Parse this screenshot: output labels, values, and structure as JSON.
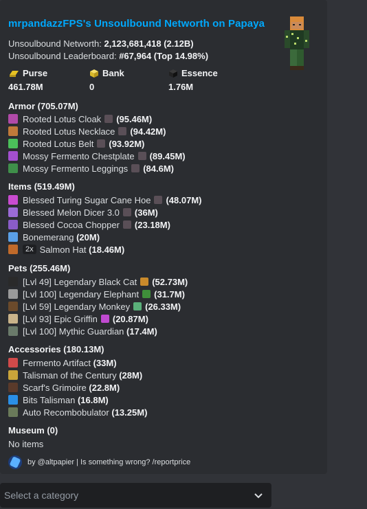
{
  "embed": {
    "title": "mrpandazzFPS's Unsoulbound Networth on Papaya",
    "networth_label": "Unsoulbound Networth:",
    "networth_value": "2,123,681,418 (2.12B)",
    "leaderboard_label": "Unsoulbound Leaderboard:",
    "leaderboard_value": "#67,964 (Top 14.98%)",
    "fields": [
      {
        "name": "Purse",
        "value": "461.78M",
        "icon": "gold-ingot-icon",
        "color": "#e6c224"
      },
      {
        "name": "Bank",
        "value": "0",
        "icon": "gold-block-icon",
        "color": "#f1d43a"
      },
      {
        "name": "Essence",
        "value": "1.76M",
        "icon": "wither-essence-icon",
        "color": "#1a1a1a"
      }
    ],
    "sections": [
      {
        "title": "Armor (705.07M)",
        "items": [
          {
            "name": "Rooted Lotus Cloak",
            "value": "(95.46M)",
            "icon": "cloak-icon",
            "color": "#b04aa8",
            "sub": "#5a4f57"
          },
          {
            "name": "Rooted Lotus Necklace",
            "value": "(94.42M)",
            "icon": "necklace-icon",
            "color": "#c07a3a",
            "sub": "#5a4f57"
          },
          {
            "name": "Rooted Lotus Belt",
            "value": "(93.92M)",
            "icon": "belt-icon",
            "color": "#4bbf5a",
            "sub": "#5a4f57"
          },
          {
            "name": "Mossy Fermento Chestplate",
            "value": "(89.45M)",
            "icon": "chestplate-icon",
            "color": "#a34fcf",
            "sub": "#5a4f57"
          },
          {
            "name": "Mossy Fermento Leggings",
            "value": "(84.6M)",
            "icon": "leggings-icon",
            "color": "#3f8f4a",
            "sub": "#5a4f57"
          }
        ]
      },
      {
        "title": "Items (519.49M)",
        "items": [
          {
            "name": "Blessed Turing Sugar Cane Hoe",
            "value": "(48.07M)",
            "icon": "hoe-icon",
            "color": "#c84bd0",
            "sub": "#5a4f57"
          },
          {
            "name": "Blessed Melon Dicer 3.0",
            "value": "(36M)",
            "icon": "axe-icon",
            "color": "#9b6bd6",
            "sub": "#5a4f57"
          },
          {
            "name": "Blessed Cocoa Chopper",
            "value": "(23.18M)",
            "icon": "axe-icon",
            "color": "#8a5cc8",
            "sub": "#5a4f57"
          },
          {
            "name": "Bonemerang",
            "value": "(20M)",
            "icon": "bone-icon",
            "color": "#5aa0e6",
            "sub": ""
          },
          {
            "name": "Salmon Hat",
            "value": "(18.46M)",
            "icon": "hat-icon",
            "color": "#c06a2a",
            "qty": "2x",
            "sub": ""
          }
        ]
      },
      {
        "title": "Pets (255.46M)",
        "items": [
          {
            "name": "[Lvl 49] Legendary Black Cat",
            "value": "(52.73M)",
            "icon": "black-cat-icon",
            "color": "#2a2a2a",
            "sub": "#c98a2b"
          },
          {
            "name": "[Lvl 100] Legendary Elephant",
            "value": "(31.7M)",
            "icon": "elephant-icon",
            "color": "#9a9a9a",
            "sub": "#3f8f3a"
          },
          {
            "name": "[Lvl 59] Legendary Monkey",
            "value": "(26.33M)",
            "icon": "monkey-icon",
            "color": "#6b4a2b",
            "sub": "#5ab07a"
          },
          {
            "name": "[Lvl 93] Epic Griffin",
            "value": "(20.87M)",
            "icon": "griffin-icon",
            "color": "#c9b38a",
            "sub": "#c04ad0"
          },
          {
            "name": "[Lvl 100] Mythic Guardian",
            "value": "(17.4M)",
            "icon": "guardian-icon",
            "color": "#6a7a6a",
            "sub": ""
          }
        ]
      },
      {
        "title": "Accessories (180.13M)",
        "items": [
          {
            "name": "Fermento Artifact",
            "value": "(33M)",
            "icon": "artifact-icon",
            "color": "#d04a4a",
            "sub": ""
          },
          {
            "name": "Talisman of the Century",
            "value": "(28M)",
            "icon": "talisman-icon",
            "color": "#c9a43a",
            "sub": ""
          },
          {
            "name": "Scarf's Grimoire",
            "value": "(22.8M)",
            "icon": "grimoire-icon",
            "color": "#5a3a2a",
            "sub": ""
          },
          {
            "name": "Bits Talisman",
            "value": "(16.8M)",
            "icon": "bits-icon",
            "color": "#2a8fe6",
            "sub": ""
          },
          {
            "name": "Auto Recombobulator",
            "value": "(13.25M)",
            "icon": "recombobulator-icon",
            "color": "#6a7a5a",
            "sub": ""
          }
        ]
      }
    ],
    "museum_title": "Museum (0)",
    "museum_text": "No items",
    "footer_text": "by @altpapier | Is something wrong? /reportprice"
  },
  "select": {
    "placeholder": "Select a category"
  },
  "colors": {
    "background": "#313338",
    "embed": "#2b2d31",
    "title_link": "#00a8fc",
    "select_bg": "#1e1f22"
  }
}
